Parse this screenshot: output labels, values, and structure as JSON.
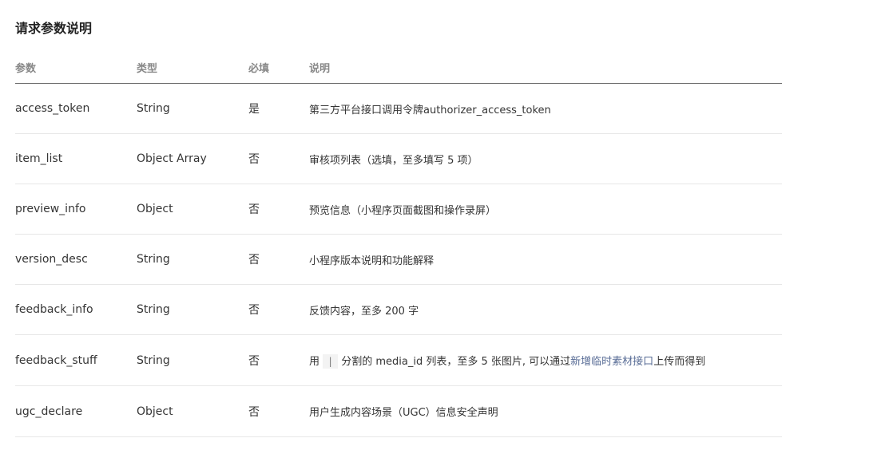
{
  "section": {
    "title": "请求参数说明"
  },
  "table": {
    "headers": {
      "param": "参数",
      "type": "类型",
      "required": "必填",
      "description": "说明"
    },
    "rows": [
      {
        "param": "access_token",
        "type": "String",
        "required": "是",
        "description": "第三方平台接口调用令牌authorizer_access_token"
      },
      {
        "param": "item_list",
        "type": "Object Array",
        "required": "否",
        "description": "审核项列表（选填，至多填写 5 项）"
      },
      {
        "param": "preview_info",
        "type": "Object",
        "required": "否",
        "description": "预览信息（小程序页面截图和操作录屏）"
      },
      {
        "param": "version_desc",
        "type": "String",
        "required": "否",
        "description": "小程序版本说明和功能解释"
      },
      {
        "param": "feedback_info",
        "type": "String",
        "required": "否",
        "description": "反馈内容，至多 200 字"
      },
      {
        "param": "feedback_stuff",
        "type": "String",
        "required": "否",
        "description_prefix": "用",
        "description_code": "|",
        "description_middle": "分割的 media_id 列表，至多 5 张图片, 可以通过",
        "description_link": "新增临时素材接口",
        "description_suffix": "上传而得到"
      },
      {
        "param": "ugc_declare",
        "type": "Object",
        "required": "否",
        "description": "用户生成内容场景（UGC）信息安全声明"
      }
    ]
  },
  "colors": {
    "link": "#576b95",
    "header_text": "#888888",
    "body_text": "#353535",
    "divider": "#e7e7e7"
  }
}
